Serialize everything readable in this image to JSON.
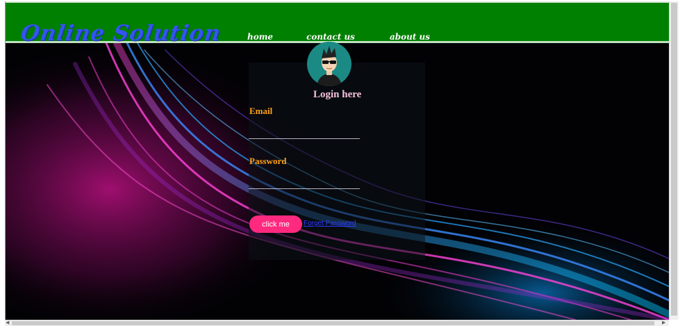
{
  "header": {
    "logo_text": "Online Solution",
    "nav": [
      {
        "label": "home"
      },
      {
        "label": "contact us"
      },
      {
        "label": "about us"
      }
    ]
  },
  "login": {
    "title": "Login here",
    "email_label": "Email",
    "email_value": "",
    "password_label": "Password",
    "password_value": "",
    "submit_label": "click me",
    "forgot_link": "Forget Password"
  },
  "colors": {
    "header_bg": "#008000",
    "logo": "#3355ee",
    "label": "#ffa31a",
    "button": "#ff2a7f",
    "title": "#f3c0dc"
  },
  "icons": {
    "avatar": "user-avatar-icon"
  }
}
